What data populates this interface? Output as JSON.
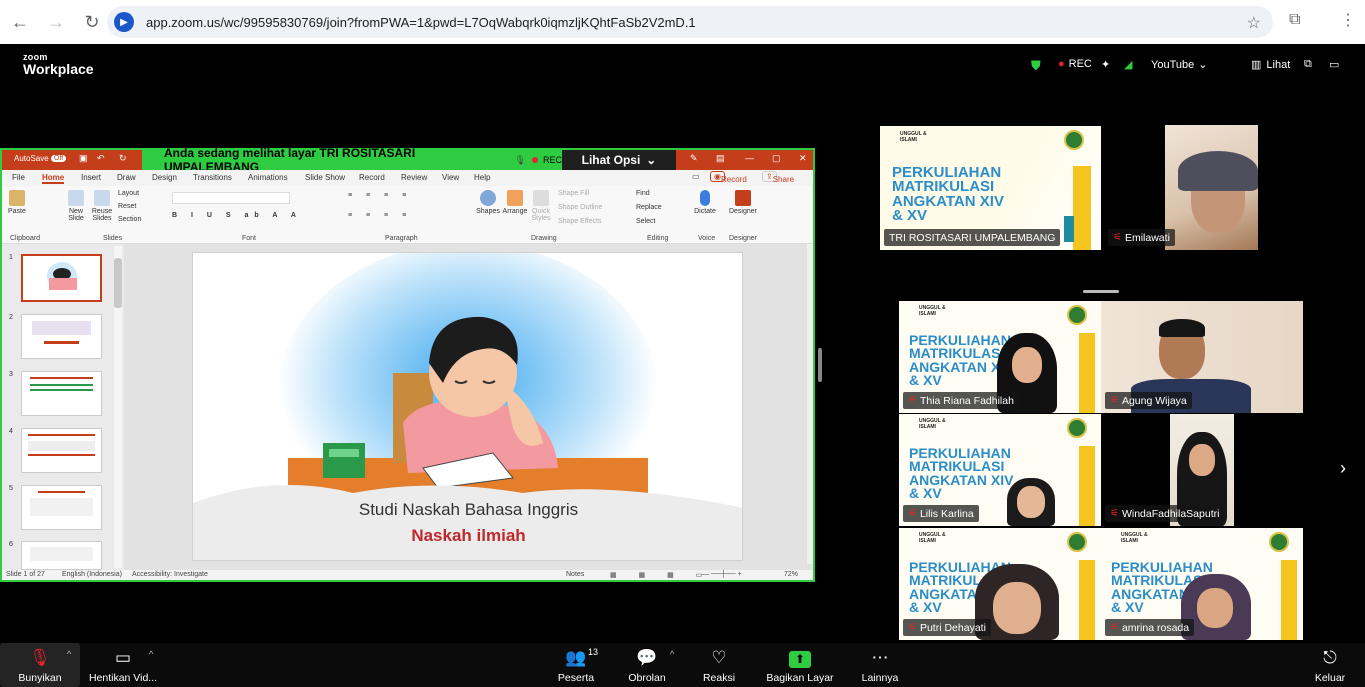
{
  "browser": {
    "url": "app.zoom.us/wc/99595830769/join?fromPWA=1&pwd=L7OqWabqrk0iqmzljKQhtFaSb2V2mD.1"
  },
  "zoom": {
    "logo_top": "zoom",
    "logo_bottom": "Workplace",
    "rec_label": "REC",
    "youtube_label": "YouTube",
    "view_label": "Lihat"
  },
  "share": {
    "banner_text": "Anda sedang melihat layar  TRI ROSITASARI UMPALEMBANG",
    "banner_rec": "REC",
    "view_options": "Lihat Opsi",
    "autosave": "AutoSave",
    "tabs": [
      "File",
      "Home",
      "Insert",
      "Draw",
      "Design",
      "Transitions",
      "Animations",
      "Slide Show",
      "Record",
      "Review",
      "View",
      "Help"
    ],
    "record_btn": "Record",
    "share_btn": "Share",
    "groups": [
      "Clipboard",
      "Slides",
      "Font",
      "Paragraph",
      "Drawing",
      "Editing",
      "Voice",
      "Designer"
    ],
    "ribbon_buttons": [
      "Paste",
      "New Slide",
      "Reuse Slides",
      "Layout",
      "Reset",
      "Section",
      "Shapes",
      "Arrange",
      "Quick Styles",
      "Shape Fill",
      "Shape Outline",
      "Shape Effects",
      "Find",
      "Replace",
      "Select",
      "Dictate",
      "Designer"
    ],
    "thumb_numbers": [
      "1",
      "2",
      "3",
      "4",
      "5",
      "6"
    ],
    "slide_title": "Studi Naskah Bahasa Inggris",
    "slide_subtitle": "Naskah ilmiah",
    "status_slide": "Slide 1 of 27",
    "status_lang": "English (Indonesia)",
    "status_access": "Accessibility: Investigate",
    "status_notes": "Notes",
    "status_zoom": "72%"
  },
  "presentation_tile": {
    "line1": "PERKULIAHAN",
    "line2": "MATRIKULASI",
    "line3": "ANGKATAN XIV",
    "line4": "& XV",
    "school_top": "UNGGUL &",
    "school_bottom": "ISLAMI"
  },
  "participants": [
    {
      "name": "TRI ROSITASARI UMPALEMBANG"
    },
    {
      "name": "Emilawati"
    },
    {
      "name": "Thia Riana Fadhilah"
    },
    {
      "name": "Agung Wijaya"
    },
    {
      "name": "Lilis Karlina"
    },
    {
      "name": "WindaFadhilaSaputri"
    },
    {
      "name": "Putri Dehayati"
    },
    {
      "name": "amrina rosada"
    }
  ],
  "toolbar": {
    "unmute": "Bunyikan",
    "stop_video": "Hentikan Vid...",
    "participants": "Peserta",
    "participants_count": "13",
    "chat": "Obrolan",
    "reactions": "Reaksi",
    "share_screen": "Bagikan Layar",
    "more": "Lainnya",
    "leave": "Keluar"
  },
  "colors": {
    "zoom_green": "#2ecc40",
    "ppt_red": "#c43e1c",
    "muted_red": "#e3242b",
    "title_blue": "#2b8ec9"
  }
}
